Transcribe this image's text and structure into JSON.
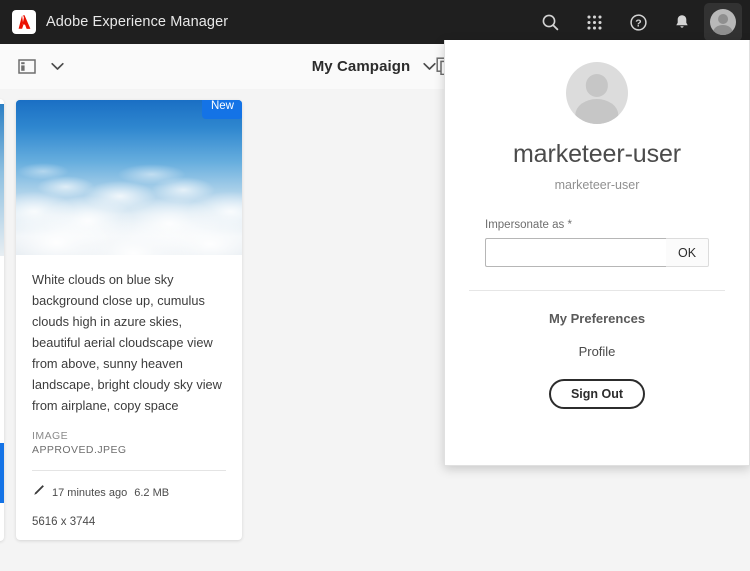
{
  "header": {
    "brand_title": "Adobe Experience Manager",
    "logo_icon": "adobe-logo-icon",
    "actions": [
      {
        "name": "search-icon",
        "label": "Search"
      },
      {
        "name": "apps-grid-icon",
        "label": "Solutions"
      },
      {
        "name": "help-icon",
        "label": "Help"
      },
      {
        "name": "notifications-bell-icon",
        "label": "Notifications"
      }
    ],
    "avatar_label": "User"
  },
  "toolbar": {
    "rail_toggle_icon": "side-panel-icon",
    "rail_chevron_icon": "chevron-down-icon",
    "title": "My Campaign",
    "title_chevron_icon": "chevron-down-icon",
    "copy_icon": "copy-icon"
  },
  "card": {
    "badge": "New",
    "description": "White clouds on blue sky background close up, cumulus clouds high in azure skies, beautiful aerial cloudscape view from above, sunny heaven landscape, bright cloudy sky view from airplane, copy space",
    "type": "IMAGE",
    "filename": "APPROVED.JPEG",
    "modified_icon": "pencil-icon",
    "modified": "17 minutes ago",
    "size": "6.2 MB",
    "dimensions": "5616 x 3744"
  },
  "popover": {
    "avatar_icon": "user-avatar-icon",
    "name": "marketeer-user",
    "subtitle": "marketeer-user",
    "impersonate_label": "Impersonate as *",
    "impersonate_value": "",
    "impersonate_placeholder": "",
    "ok_label": "OK",
    "preferences_label": "My Preferences",
    "profile_label": "Profile",
    "signout_label": "Sign Out"
  },
  "colors": {
    "header_bg": "#1f1f1f",
    "page_bg": "#f4f4f4",
    "accent_blue": "#1473e6",
    "adobe_red": "#eb1000"
  }
}
